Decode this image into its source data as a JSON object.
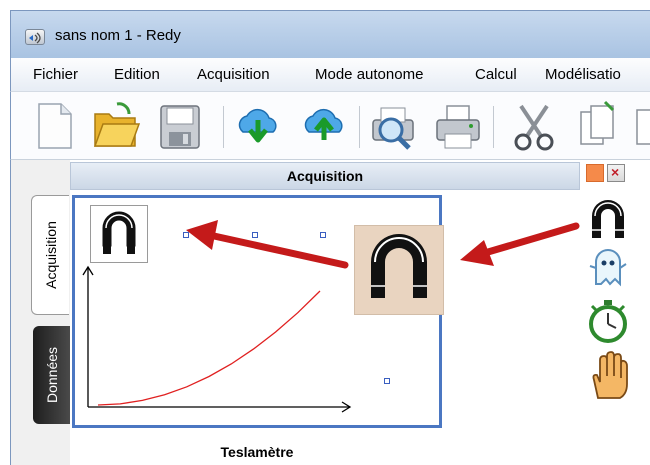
{
  "window": {
    "title": "sans nom 1 - Redy",
    "app_icon": "redy-app-icon"
  },
  "menu": {
    "items": [
      {
        "label": "Fichier"
      },
      {
        "label": "Edition"
      },
      {
        "label": "Acquisition"
      },
      {
        "label": "Mode autonome"
      },
      {
        "label": "Calcul"
      },
      {
        "label": "Modélisatio"
      }
    ]
  },
  "toolbar": {
    "buttons": [
      {
        "icon": "new-document-icon"
      },
      {
        "icon": "open-folder-icon"
      },
      {
        "icon": "save-floppy-icon"
      },
      {
        "icon": "cloud-download-icon"
      },
      {
        "icon": "cloud-upload-icon"
      },
      {
        "icon": "print-preview-icon"
      },
      {
        "icon": "printer-icon"
      },
      {
        "icon": "scissors-icon"
      },
      {
        "icon": "copy-icon"
      }
    ]
  },
  "side_tabs": {
    "acquisition": "Acquisition",
    "donnees": "Données"
  },
  "panel": {
    "title": "Acquisition"
  },
  "widget": {
    "caption": "Teslamètre",
    "sensor_icon": "horseshoe-magnet-icon"
  },
  "chart_data": {
    "type": "line",
    "title": "",
    "xlabel": "",
    "ylabel": "",
    "series": [
      {
        "values": [
          [
            0,
            0
          ],
          [
            0.1,
            0.01
          ],
          [
            0.2,
            0.04
          ],
          [
            0.3,
            0.09
          ],
          [
            0.4,
            0.16
          ],
          [
            0.5,
            0.25
          ],
          [
            0.6,
            0.36
          ],
          [
            0.7,
            0.49
          ],
          [
            0.8,
            0.64
          ],
          [
            0.9,
            0.81
          ],
          [
            1.0,
            1.0
          ]
        ],
        "color": "#e02020"
      }
    ]
  },
  "right_icons": [
    {
      "icon": "horseshoe-magnet-icon"
    },
    {
      "icon": "ghost-icon"
    },
    {
      "icon": "stopwatch-icon"
    },
    {
      "icon": "hand-stop-icon"
    }
  ],
  "colors": {
    "accent_blue": "#4b77c2",
    "arrow_red": "#c41a1a",
    "curve_red": "#e02020",
    "magnet_bg": "#e9d4c0"
  }
}
